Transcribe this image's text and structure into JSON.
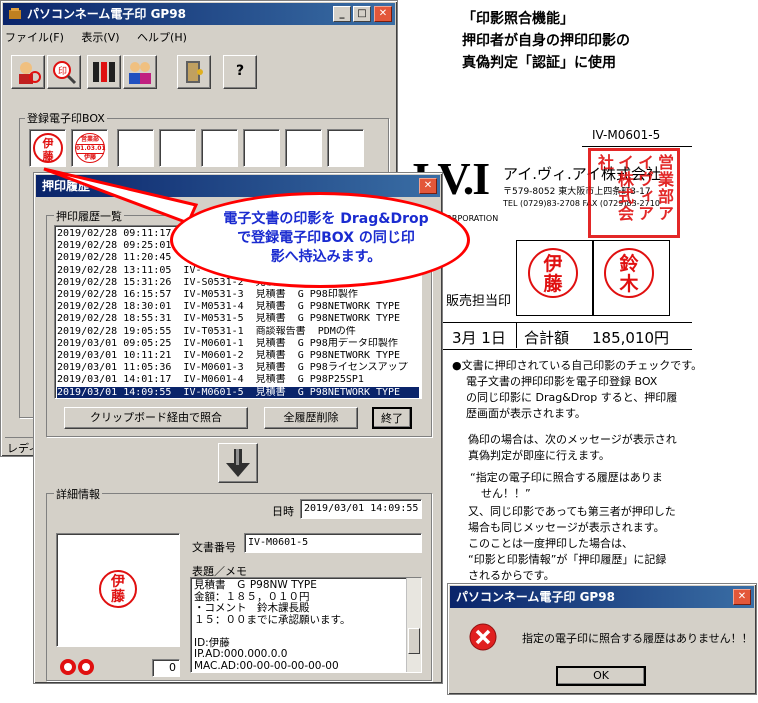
{
  "main_window": {
    "title": "パソコンネーム電子印 GP98",
    "menu": [
      "ファイル(F)",
      "表示(V)",
      "ヘルプ(H)"
    ],
    "help_button": "?",
    "box_label": "登録電子印BOX",
    "seal1": "伊藤",
    "seal2_top": "営業部",
    "seal2_mid": "01.03.01",
    "seal2_bottom": "伊藤",
    "status": "レディ"
  },
  "history_dialog": {
    "title": "押印履歴",
    "list_label": "押印履歴一覧",
    "rows": [
      "2019/02/28 09:11:17",
      "2019/02/28 09:25:01",
      "2019/02/28 11:20:45",
      "2019/02/28 13:11:05  IV-",
      "2019/02/28 15:31:26  IV-S0531-2  見積書  組込用社印製作",
      "2019/02/28 16:15:57  IV-M0531-3  見積書  G P98印製作",
      "2019/02/28 18:30:01  IV-M0531-4  見積書  G P98NETWORK TYPE",
      "2019/02/28 18:55:31  IV-M0531-5  見積書  G P98NETWORK TYPE",
      "2019/02/28 19:05:55  IV-T0531-1  商談報告書  PDMの件",
      "2019/03/01 09:05:25  IV-M0601-1  見積書  G P98用データ印製作",
      "2019/03/01 10:11:21  IV-M0601-2  見積書  G P98NETWORK TYPE",
      "2019/03/01 11:05:36  IV-M0601-3  見積書  G P98ライセンスアップ",
      "2019/03/01 14:01:17  IV-M0601-4  見積書  G P98P25SP1",
      "2019/03/01 14:09:55  IV-M0601-5  見積書  G P98NETWORK TYPE"
    ],
    "btn_clipboard": "クリップボード経由で照合",
    "btn_delete_all": "全履歴削除",
    "btn_exit": "終了",
    "detail_label": "詳細情報",
    "datetime_label": "日時",
    "datetime_value": "2019/03/01 14:09:55",
    "docno_label": "文書番号",
    "docno_value": "IV-M0601-5",
    "memo_label": "表題／メモ",
    "memo_lines": [
      "見積書　Ｇ P98NW TYPE",
      "金額：１８５，０１０円",
      "・コメント　鈴木課長殿",
      "１５：００までに承認願います。",
      "",
      "ID:伊藤",
      "IP.AD:000.000.0.0",
      "MAC.AD:00-00-00-00-00-00"
    ],
    "preview_seal": "伊藤",
    "counter_value": "0"
  },
  "callout": {
    "line1": "電子文書の印影を Drag&Drop",
    "line2": "で登録電子印BOX の同じ印",
    "line3": "影へ持込みます。"
  },
  "heading": {
    "line1": "「印影照合機能」",
    "line2": "押印者が自身の押印印影の",
    "line3": "真偽判定「認証」に使用"
  },
  "document": {
    "docno": "IV-M0601-5",
    "logo": "I.V.I",
    "logo_sub": "CORPORATION",
    "company": "アイ.ヴィ.アイ株式会社",
    "address": "〒579-8052 東大阪市上四条町3-17",
    "tel": "TEL (0729)83-2708  FAX (0729)83-2710",
    "company_seal": "営業部アイヴィアイ株式会社",
    "label_staff": "販売担当印",
    "seal_ito": "伊藤",
    "seal_suzuki": "鈴木",
    "date_text": "3月 1日",
    "total_label": "合計額",
    "total_value": "185,010円"
  },
  "description": [
    "●文書に押印されている自己印影のチェックです。",
    "電子文書の押印印影を電子印登録 BOX",
    "の同じ印影に Drag&Drop すると、押印履",
    "歴画面が表示されます。",
    "",
    "偽印の場合は、次のメッセージが表示され",
    "真偽判定が即座に行えます。",
    "“指定の電子印に照合する履歴はありま",
    "　せん！！”",
    "又、同じ印影であっても第三者が押印した",
    "場合も同じメッセージが表示されます。",
    "このことは一度押印した場合は、",
    "“印影と印影情報”が「押印履歴」に記録",
    "されるからです。"
  ],
  "message_dialog": {
    "title": "パソコンネーム電子印 GP98",
    "message": "指定の電子印に照合する履歴はありません！！",
    "ok": "OK"
  },
  "colors": {
    "title_blue": "#0a246a",
    "seal_red": "#e01010",
    "callout_red": "#ff0000",
    "callout_text": "#1a2bd0"
  }
}
